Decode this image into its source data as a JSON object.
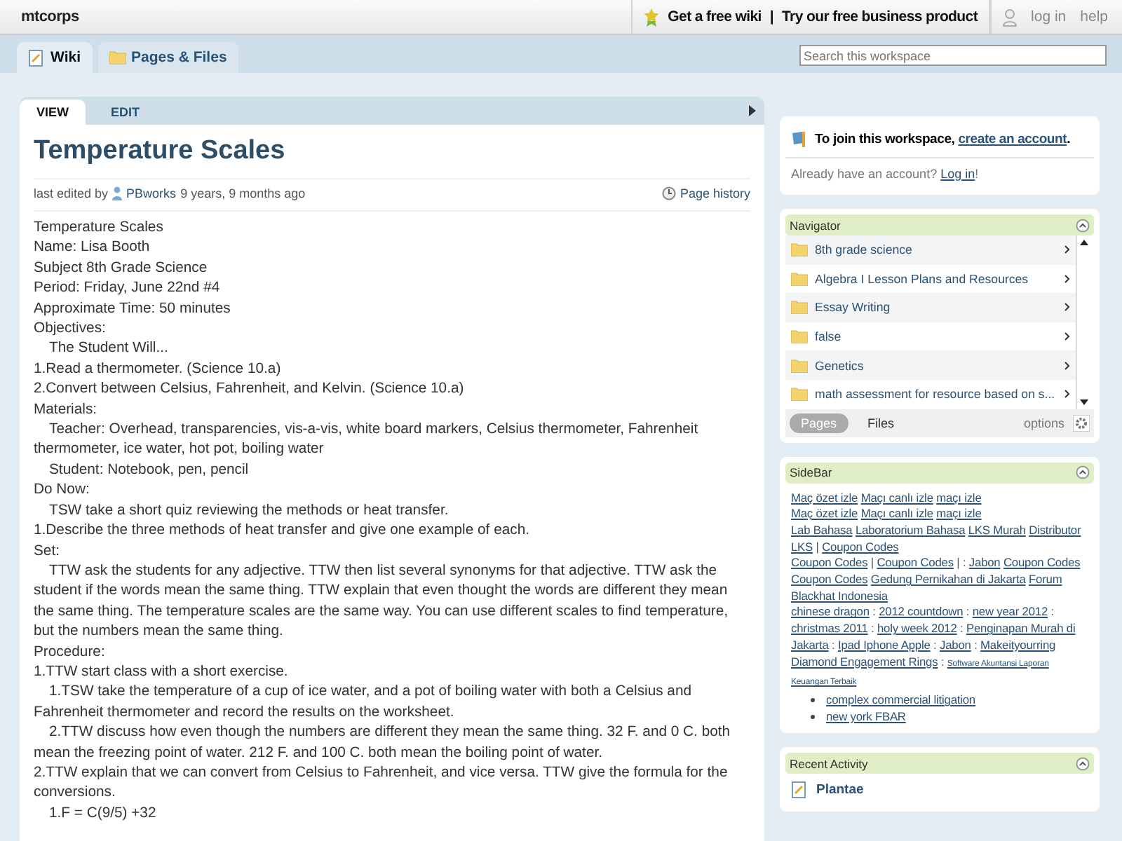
{
  "topbar": {
    "site": "mtcorps",
    "free_wiki": "Get a free wiki",
    "separator": "|",
    "business": "Try our free business product",
    "login": "log in",
    "help": "help"
  },
  "nav_tabs": [
    {
      "label": "Wiki",
      "selected": true
    },
    {
      "label": "Pages & Files",
      "selected": false
    }
  ],
  "search": {
    "placeholder": "Search this workspace"
  },
  "page_tabs": [
    {
      "label": "VIEW",
      "selected": true
    },
    {
      "label": "EDIT",
      "selected": false
    }
  ],
  "page": {
    "title": "Temperature Scales",
    "edited_prefix": "last edited by",
    "editor": "PBworks",
    "edited_time": "9 years, 9 months ago",
    "history": "Page history",
    "lines": [
      {
        "text": "Temperature Scales",
        "indent": false
      },
      {
        "text": "Name: Lisa Booth",
        "indent": false
      },
      {
        "text": "Subject 8th Grade Science",
        "indent": false
      },
      {
        "text": "Period: Friday, June 22nd #4",
        "indent": false
      },
      {
        "text": "Approximate Time: 50 minutes",
        "indent": false
      },
      {
        "text": "Objectives:",
        "indent": false
      },
      {
        "text": "The Student Will...",
        "indent": true
      },
      {
        "text": "1.Read a thermometer. (Science 10.a)",
        "indent": false
      },
      {
        "text": "2.Convert between Celsius, Fahrenheit, and Kelvin. (Science 10.a)",
        "indent": false
      },
      {
        "text": "Materials:",
        "indent": false
      },
      {
        "text": "Teacher: Overhead, transparencies, vis-a-vis, white board markers, Celsius thermometer, Fahrenheit thermometer, ice water, hot pot, boiling water",
        "indent": true
      },
      {
        "text": "Student: Notebook, pen, pencil",
        "indent": true
      },
      {
        "text": "Do Now:",
        "indent": false
      },
      {
        "text": "TSW take a short quiz reviewing the methods or heat transfer.",
        "indent": true
      },
      {
        "text": "1.Describe the three methods of heat transfer and give one example of each.",
        "indent": false
      },
      {
        "text": "Set:",
        "indent": false
      },
      {
        "text": "TTW ask the students for any adjective.  TTW then list several synonyms for that adjective.  TTW ask the student if the words mean the same thing.  TTW explain that even thought the words are different they mean the same thing.  The temperature scales are the same way.  You can use different scales to find temperature, but the numbers mean the same thing.",
        "indent": true
      },
      {
        "text": "Procedure:",
        "indent": false
      },
      {
        "text": "1.TTW start class with a short exercise.",
        "indent": false
      },
      {
        "text": "1.TSW take the temperature of a cup of ice water, and a pot of boiling water with both a Celsius and Fahrenheit thermometer and record the results on the worksheet.",
        "indent": true
      },
      {
        "text": "2.TTW discuss how even though the numbers are different they mean the same thing.  32 F. and 0 C. both mean the freezing point of water.  212 F. and 100 C. both mean the boiling point of water.",
        "indent": true
      },
      {
        "text": "2.TTW explain that we can convert from Celsius to Fahrenheit, and vice versa.  TTW give the formula for the conversions.",
        "indent": false
      },
      {
        "text": "1.F = C(9/5) +32",
        "indent": true
      }
    ]
  },
  "join": {
    "prefix": "To join this workspace,",
    "link": "create an account",
    "suffix": ".",
    "already": "Already have an account?",
    "login": "Log in",
    "bang": "!"
  },
  "navigator": {
    "title": "Navigator",
    "folders": [
      "8th grade science",
      "Algebra I Lesson Plans and Resources",
      "Essay Writing",
      "false",
      "Genetics",
      "math assessment for resource based on s..."
    ],
    "tabs": [
      {
        "label": "Pages",
        "selected": true
      },
      {
        "label": "Files",
        "selected": false
      }
    ],
    "options": "options"
  },
  "sidebar": {
    "title": "SideBar",
    "paragraphs": [
      [
        {
          "kind": "link",
          "text": "Maç özet izle"
        },
        {
          "kind": "link",
          "text": "Maçı canlı izle"
        },
        {
          "kind": "link",
          "text": "maçı izle"
        }
      ],
      [
        {
          "kind": "link",
          "text": "Maç özet izle"
        },
        {
          "kind": "link",
          "text": "Maçı canlı izle"
        },
        {
          "kind": "link",
          "text": "maçı izle"
        }
      ],
      [
        {
          "kind": "link",
          "text": "Lab Bahasa"
        },
        {
          "kind": "link",
          "text": "Laboratorium Bahasa"
        },
        {
          "kind": "link",
          "text": "LKS Murah"
        },
        {
          "kind": "link",
          "text": "Distributor"
        },
        {
          "kind": "link",
          "text": "LKS"
        },
        {
          "kind": "text",
          "text": "|"
        },
        {
          "kind": "link",
          "text": "Coupon Codes"
        }
      ],
      [
        {
          "kind": "link",
          "text": "Coupon Codes"
        },
        {
          "kind": "text",
          "text": "|"
        },
        {
          "kind": "link",
          "text": "Coupon Codes"
        },
        {
          "kind": "text",
          "text": "| :"
        },
        {
          "kind": "link",
          "text": "Jabon"
        },
        {
          "kind": "link",
          "text": "Coupon Codes"
        },
        {
          "kind": "link",
          "text": "Coupon Codes"
        },
        {
          "kind": "link",
          "text": "Gedung Pernikahan di Jakarta"
        },
        {
          "kind": "link",
          "text": "Forum"
        },
        {
          "kind": "link",
          "text": "Blackhat Indonesia"
        }
      ],
      [
        {
          "kind": "link",
          "text": "chinese dragon"
        },
        {
          "kind": "text",
          "text": ":"
        },
        {
          "kind": "link",
          "text": "2012 countdown"
        },
        {
          "kind": "text",
          "text": ":"
        },
        {
          "kind": "link",
          "text": "new year 2012"
        },
        {
          "kind": "text",
          "text": ":"
        },
        {
          "kind": "link",
          "text": "christmas 2011"
        },
        {
          "kind": "text",
          "text": ":"
        },
        {
          "kind": "link",
          "text": "holy week 2012"
        },
        {
          "kind": "text",
          "text": ":"
        },
        {
          "kind": "link",
          "text": "Penginapan Murah di"
        },
        {
          "kind": "link",
          "text": "Jakarta"
        },
        {
          "kind": "text",
          "text": ":"
        },
        {
          "kind": "link",
          "text": "Ipad Iphone Apple"
        },
        {
          "kind": "text",
          "text": ":"
        },
        {
          "kind": "link",
          "text": "Jabon"
        },
        {
          "kind": "text",
          "text": ":"
        },
        {
          "kind": "link",
          "text": "Makeityourring"
        },
        {
          "kind": "link",
          "text": "Diamond Engagement Rings"
        },
        {
          "kind": "text",
          "text": ":"
        },
        {
          "kind": "small",
          "text": "Software Akuntansi Laporan"
        },
        {
          "kind": "small",
          "text": "Keuangan Terbaik"
        }
      ]
    ],
    "bullets": [
      "complex commercial litigation",
      "new york FBAR"
    ]
  },
  "recent": {
    "title": "Recent Activity",
    "items": [
      "Plantae"
    ]
  }
}
